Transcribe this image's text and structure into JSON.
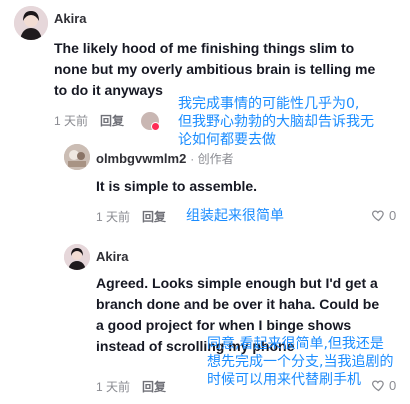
{
  "comment": {
    "username": "Akira",
    "text_lines": [
      "The likely hood of me finishing things slim to",
      "none but my overly ambitious brain is telling me",
      "to do it anyways"
    ],
    "time": "1 天前",
    "reply_label": "回复",
    "overlay_lines": [
      "我完成事情的可能性几乎为0,",
      "但我野心勃勃的大脑却告诉我无",
      "论如何都要去做"
    ]
  },
  "reply1": {
    "username": "olmbgvwmlm2",
    "creator_tag": "· 创作者",
    "text": "It is simple to assemble.",
    "time": "1 天前",
    "reply_label": "回复",
    "overlay": "组装起来很简单",
    "likes": "0"
  },
  "reply2": {
    "username": "Akira",
    "text_lines": [
      "Agreed. Looks simple enough but I'd get a",
      "branch done and be over it haha. Could be",
      "a good project for when I binge shows",
      "instead of scrolling my phone"
    ],
    "time": "1 天前",
    "reply_label": "回复",
    "overlay_lines": [
      "同意,看起来很简单,但我还是",
      "想先完成一个分支,当我追剧的",
      "时候可以用来代替刷手机"
    ],
    "likes": "0"
  },
  "icons": {
    "like": "heart-outline-icon"
  },
  "colors": {
    "overlay": "#1a8cff",
    "meta": "#8a8b91"
  }
}
